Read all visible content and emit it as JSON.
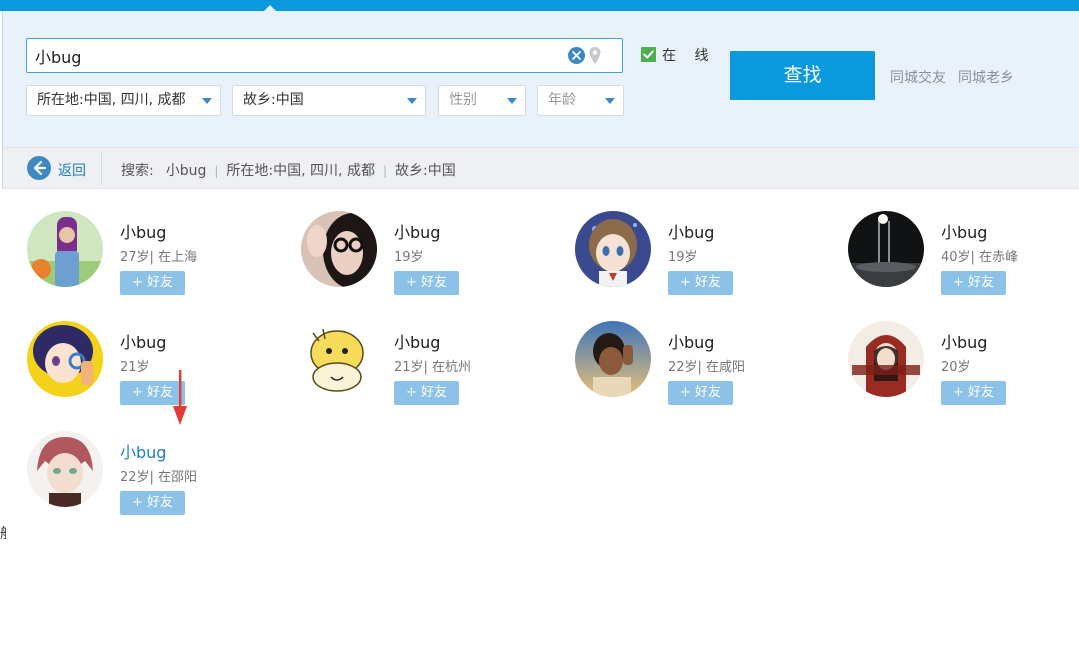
{
  "search": {
    "query": "小bug",
    "online_label": "在 线",
    "find_label": "查找",
    "link_local": "同城交友",
    "link_hometown": "同城老乡"
  },
  "filters": {
    "location": "所在地:中国, 四川, 成都",
    "hometown": "故乡:中国",
    "gender": "性别",
    "age": "年龄"
  },
  "crumbs": {
    "back_label": "返回",
    "search_label": "搜索:",
    "query": "小bug",
    "location": "所在地:中国, 四川, 成都",
    "hometown": "故乡:中国",
    "sep": "|"
  },
  "add_label": "+ 好友",
  "results": [
    {
      "name": "小bug",
      "info": "27岁| 在上海"
    },
    {
      "name": "小bug",
      "info": "19岁"
    },
    {
      "name": "小bug",
      "info": "19岁"
    },
    {
      "name": "小bug",
      "info": "40岁| 在赤峰"
    },
    {
      "name": "小bug",
      "info": "21岁"
    },
    {
      "name": "小bug",
      "info": "21岁| 在杭州"
    },
    {
      "name": "小bug",
      "info": "22岁| 在咸阳"
    },
    {
      "name": "小bug",
      "info": "20岁"
    },
    {
      "name": "小bug",
      "info": "22岁| 在邵阳"
    }
  ],
  "edge_glyph": "船",
  "colors": {
    "accent": "#0a99dc",
    "add_button": "#8dc2e8",
    "highlight": "#1e7fc4",
    "annotation": "#e53935"
  }
}
